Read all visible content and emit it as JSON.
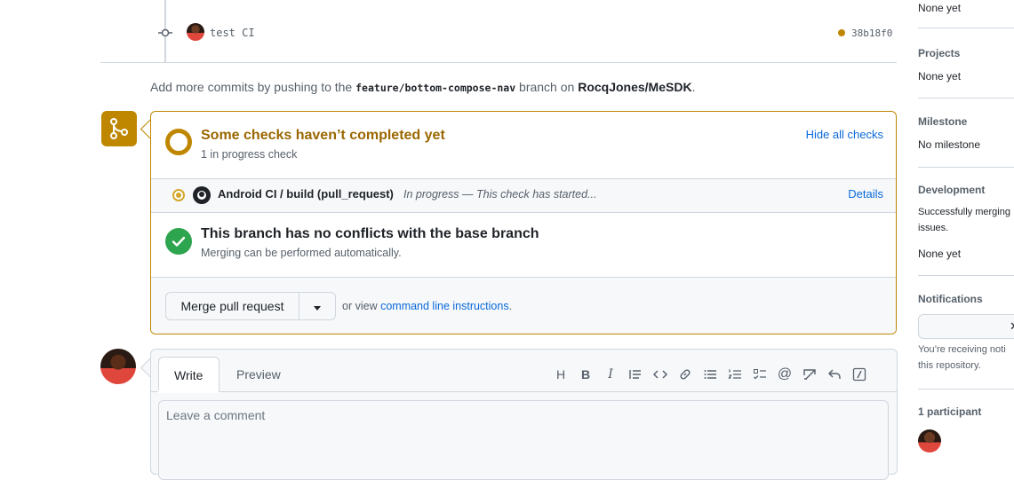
{
  "commit": {
    "message": "test CI",
    "sha": "38b18f0"
  },
  "push_hint": {
    "prefix": "Add more commits by pushing to the",
    "branch": "feature/bottom-compose-nav",
    "middle": "branch on",
    "repo": "RocqJones/MeSDK",
    "suffix": "."
  },
  "checks": {
    "title": "Some checks haven’t completed yet",
    "subtitle": "1 in progress check",
    "hide_label": "Hide all checks",
    "items": [
      {
        "name": "Android CI / build (pull_request)",
        "status": "In progress — This check has started...",
        "details_label": "Details"
      }
    ]
  },
  "conflicts": {
    "title": "This branch has no conflicts with the base branch",
    "subtitle": "Merging can be performed automatically."
  },
  "merge": {
    "button_label": "Merge pull request",
    "or_view": "or view",
    "cli_link": "command line instructions",
    "cli_suffix": "."
  },
  "comment": {
    "tab_write": "Write",
    "tab_preview": "Preview",
    "placeholder": "Leave a comment",
    "toolbar_icons": [
      "heading-icon",
      "bold-icon",
      "italic-icon",
      "quote-icon",
      "code-icon",
      "link-icon",
      "unordered-list-icon",
      "ordered-list-icon",
      "task-list-icon",
      "mention-icon",
      "reference-icon",
      "reply-icon",
      "slash-command-icon"
    ]
  },
  "sidebar": {
    "top_value": "None yet",
    "projects_title": "Projects",
    "projects_value": "None yet",
    "milestone_title": "Milestone",
    "milestone_value": "No milestone",
    "development_title": "Development",
    "development_text_1": "Successfully merging",
    "development_text_2": "issues.",
    "development_value": "None yet",
    "notifications_title": "Notifications",
    "notifications_text_1": "You’re receiving noti",
    "notifications_text_2": "this repository.",
    "participants_title": "1 participant"
  },
  "colors": {
    "pending": "#bf8700",
    "success": "#2da44e",
    "link": "#0969da",
    "border": "#d0d7de"
  }
}
